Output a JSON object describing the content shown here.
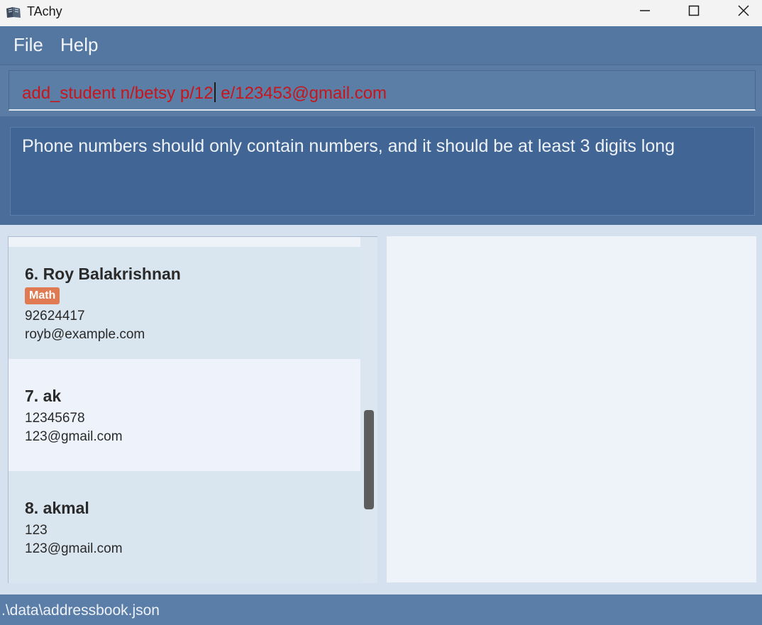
{
  "window": {
    "title": "TAchy",
    "controls": [
      "minimize-icon",
      "maximize-icon",
      "close-icon"
    ]
  },
  "menu": {
    "file": "File",
    "help": "Help"
  },
  "command": {
    "before_caret": "add_student n/betsy p/12",
    "after_caret": " e/123453@gmail.com",
    "text_color": "#c8151b"
  },
  "result": {
    "message": "Phone numbers should only contain numbers, and it should be at least 3 digits long"
  },
  "students": [
    {
      "name": "6. Roy Balakrishnan",
      "tag": "Math",
      "phone": "92624417",
      "email": "royb@example.com"
    },
    {
      "name": "7. ak",
      "phone": "12345678",
      "email": "123@gmail.com"
    },
    {
      "name": "8. akmal",
      "phone": "123",
      "email": "123@gmail.com"
    }
  ],
  "status": {
    "path": ".\\data\\addressbook.json"
  },
  "colors": {
    "menubar": "#5477a1",
    "result": "#416594",
    "tag": "#e07a52",
    "status": "#5b7ea9"
  }
}
